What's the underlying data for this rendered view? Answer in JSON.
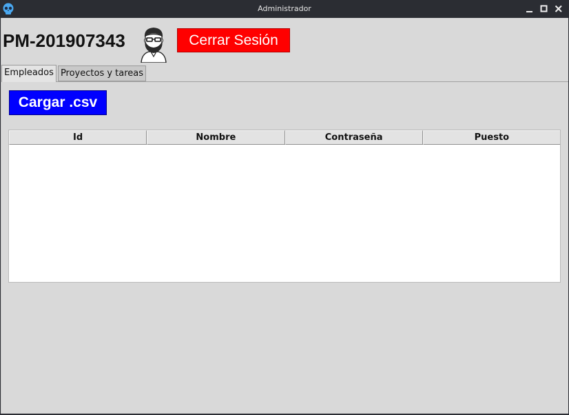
{
  "window": {
    "title": "Administrador",
    "app_icon": "skull-app-icon",
    "controls": [
      "minimize-icon",
      "maximize-icon",
      "close-icon"
    ]
  },
  "header": {
    "user_id": "PM-201907343",
    "avatar_icon": "bearded-man-avatar",
    "logout_label": "Cerrar Sesión"
  },
  "tabs": [
    {
      "label": "Empleados",
      "active": true
    },
    {
      "label": "Proyectos y tareas",
      "active": false
    }
  ],
  "employees": {
    "load_button_label": "Cargar .csv",
    "table": {
      "columns": [
        "Id",
        "Nombre",
        "Contraseña",
        "Puesto"
      ],
      "rows": []
    }
  },
  "colors": {
    "logout_bg": "#ff0000",
    "load_bg": "#0000ff",
    "titlebar_bg": "#2b2d33",
    "client_bg": "#d9d9d9"
  }
}
